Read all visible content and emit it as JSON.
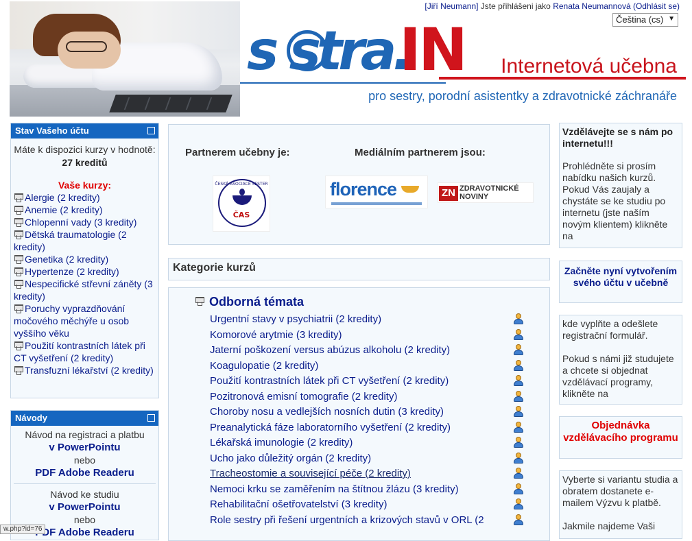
{
  "userbar": {
    "user_link": "[Jiří Neumann]",
    "logged_text": "Jste přihlášeni jako",
    "as_user": "Renata Neumannová",
    "logout": "(Odhlásit se)"
  },
  "language": {
    "selected": "Čeština (cs)"
  },
  "header": {
    "logo_main": "s  stra.",
    "logo_in": "IN",
    "title": "Internetová učebna",
    "subtitle": "pro sestry, porodní asistentky a zdravotnické záchranáře"
  },
  "account": {
    "title": "Stav Vašeho účtu",
    "available_text": "Máte k dispozici kurzy v hodnotě:",
    "credits": "27 kreditů",
    "your_courses": "Vaše kurzy:",
    "courses": [
      "Alergie (2 kredity)",
      "Anemie (2 kredity)",
      "Chlopenní vady (3 kredity)",
      "Dětská traumatologie (2 kredity)",
      "Genetika (2 kredity)",
      "Hypertenze (2 kredity)",
      "Nespecifické střevní záněty (3 kredity)",
      "Poruchy vyprazdňování močového měchýře u osob vyššího věku",
      "Použití kontrastních látek při CT vyšetření (2 kredity)",
      "Transfuzní lékařství (2 kredity)"
    ]
  },
  "guides": {
    "title": "Návody",
    "reg_text": "Návod na registraci a platbu",
    "reg_ppt": "v PowerPointu",
    "or1": "nebo",
    "reg_pdf": "PDF Adobe Readeru",
    "study_text": "Návod ke studiu",
    "study_ppt": "v PowerPointu",
    "or2": "nebo",
    "study_pdf": "PDF Adobe Readeru"
  },
  "status_url": "w.php?id=76",
  "partners": {
    "partner_label": "Partnerem učebny je:",
    "media_label": "Mediálním partnerem jsou:",
    "cas_ring": "ČESKÁ ASOCIACE SESTER",
    "cas_abbr": "ČAS",
    "florence": "florence",
    "zn_abbr": "ZN",
    "zn_name": "ZDRAVOTNICKÉ NOVINY"
  },
  "categories": {
    "heading": "Kategorie kurzů",
    "category_name": "Odborná témata",
    "courses": [
      "Urgentní stavy v psychiatrii (2 kredity)",
      "Komorové arytmie (3 kredity)",
      "Jaterní poškození versus abúzus alkoholu (2 kredity)",
      "Koagulopatie (2 kredity)",
      "Použití kontrastních látek při CT vyšetření (2 kredity)",
      "Pozitronová emisní tomografie (2 kredity)",
      "Choroby nosu a vedlejších nosních dutin (3 kredity)",
      "Preanalytická fáze laboratorního vyšetření (2 kredity)",
      "Lékařská imunologie (2 kredity)",
      "Ucho jako důležitý orgán (2 kredity)",
      "Tracheostomie a související péče (2 kredity)",
      "Nemoci krku se zaměřením na štítnou žlázu (3 kredity)",
      "Rehabilitační ošetřovatelství (3 kredity)",
      "Role sestry při řešení urgentních a krizových stavů v ORL (2"
    ]
  },
  "right": {
    "intro_title": "Vzdělávejte se s nám po internetu!!!",
    "intro_text": "Prohlédněte si prosím nabídku našich kurzů. Pokud Vás zaujaly a chystáte se ke studiu po internetu (jste naším novým klientem) klikněte na",
    "create_account": "Začněte nyní vytvořením svého účtu v učebně",
    "fill_text": "kde vyplňte a odešlete registrační formulář.",
    "already_text": "Pokud s námi již studujete a chcete si objednat vzdělávací programy, klikněte na",
    "order_link": "Objednávka vzdělávacího programu",
    "choose_text": "Vyberte si variantu studia a obratem dostanete e-mailem Výzvu k platbě.",
    "once_text": "Jakmile najdeme Vaši"
  }
}
